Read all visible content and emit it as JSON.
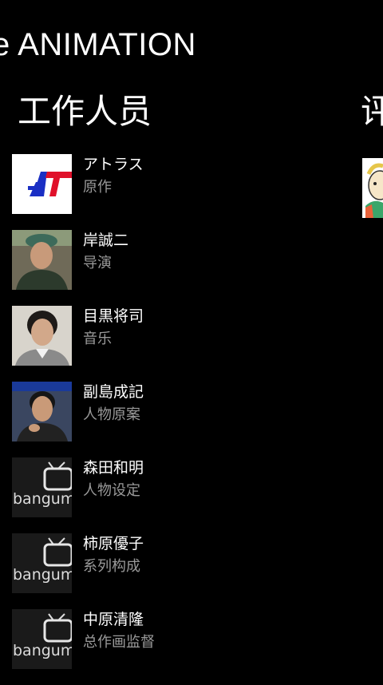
{
  "app": {
    "title": "e ANIMATION"
  },
  "sections": {
    "staff": "工作人员",
    "comments": "评"
  },
  "staff": [
    {
      "name": "アトラス",
      "role": "原作",
      "avatar": "atlus-logo-image"
    },
    {
      "name": "岸誠二",
      "role": "导演",
      "avatar": "person-photo"
    },
    {
      "name": "目黒将司",
      "role": "音乐",
      "avatar": "person-photo"
    },
    {
      "name": "副島成記",
      "role": "人物原案",
      "avatar": "person-photo"
    },
    {
      "name": "森田和明",
      "role": "人物设定",
      "avatar": "bangumi-placeholder-image"
    },
    {
      "name": "柿原優子",
      "role": "系列构成",
      "avatar": "bangumi-placeholder-image"
    },
    {
      "name": "中原清隆",
      "role": "总作画监督",
      "avatar": "bangumi-placeholder-image"
    }
  ],
  "placeholder_text": "bangumi",
  "colors": {
    "background": "#000000",
    "text": "#ffffff",
    "secondary_text": "#9a9a9a",
    "atlus_blue": "#1a2fc4",
    "atlus_red": "#e0102a"
  }
}
